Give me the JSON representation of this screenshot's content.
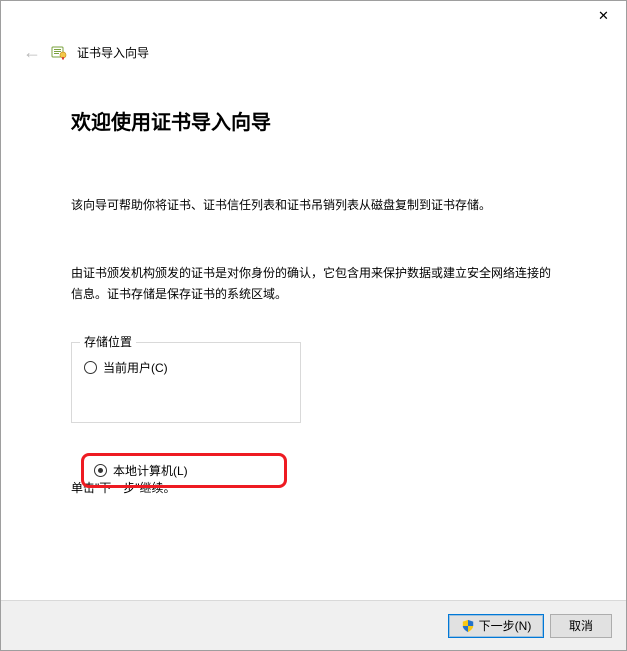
{
  "window": {
    "close_icon_name": "close-icon"
  },
  "header": {
    "back_icon_name": "back-arrow-icon",
    "wizard_icon_name": "certificate-wizard-icon",
    "title": "证书导入向导"
  },
  "page": {
    "heading": "欢迎使用证书导入向导",
    "description1": "该向导可帮助你将证书、证书信任列表和证书吊销列表从磁盘复制到证书存储。",
    "description2": "由证书颁发机构颁发的证书是对你身份的确认，它包含用来保护数据或建立安全网络连接的信息。证书存储是保存证书的系统区域。",
    "continue_note": "单击\"下一步\"继续。"
  },
  "store_location": {
    "legend": "存储位置",
    "options": [
      {
        "label": "当前用户(C)",
        "checked": false,
        "name": "radio-current-user"
      },
      {
        "label": "本地计算机(L)",
        "checked": true,
        "name": "radio-local-machine"
      }
    ]
  },
  "footer": {
    "shield_icon_name": "uac-shield-icon",
    "next_label": "下一步(N)",
    "cancel_label": "取消"
  }
}
